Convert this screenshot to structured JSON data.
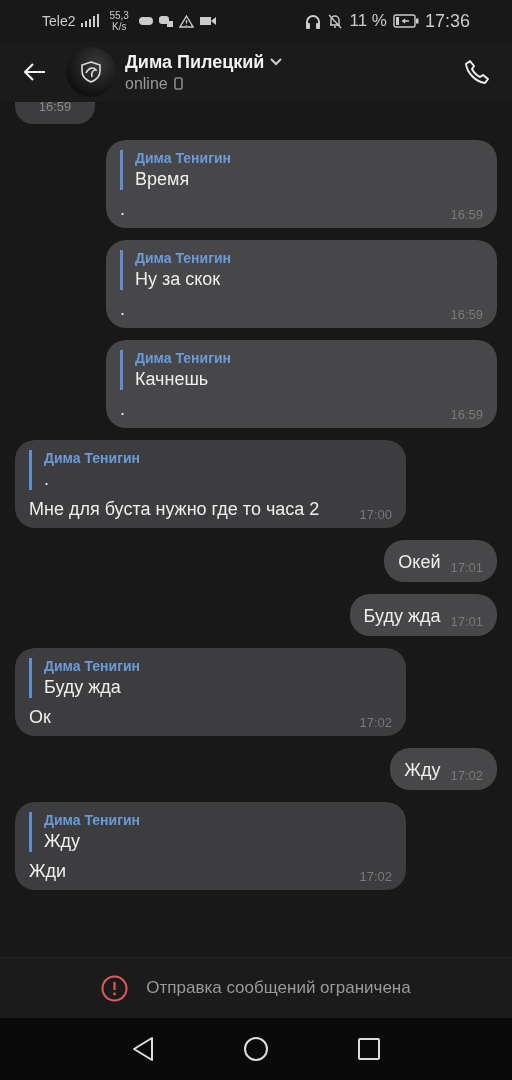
{
  "status_bar": {
    "carrier": "Tele2",
    "net_speed": "55,3",
    "net_speed_unit": "K/s",
    "battery_percent": "11 %",
    "time": "17:36"
  },
  "header": {
    "name": "Дима Пилецкий",
    "status": "online"
  },
  "messages": [
    {
      "kind": "partial_incoming",
      "time": "16:59"
    },
    {
      "kind": "reply_outgoing",
      "quote_author": "Дима Тенигин",
      "quote_text": "Время",
      "text": ".",
      "time": "16:59"
    },
    {
      "kind": "reply_outgoing",
      "quote_author": "Дима Тенигин",
      "quote_text": "Ну за скок",
      "text": ".",
      "time": "16:59"
    },
    {
      "kind": "reply_outgoing",
      "quote_author": "Дима Тенигин",
      "quote_text": "Качнешь",
      "text": ".",
      "time": "16:59"
    },
    {
      "kind": "reply_incoming",
      "quote_author": "Дима Тенигин",
      "quote_text": ".",
      "text": "Мне для буста нужно где то часа 2",
      "time": "17:00"
    },
    {
      "kind": "plain_outgoing",
      "text": "Окей",
      "time": "17:01"
    },
    {
      "kind": "plain_outgoing",
      "text": "Буду жда",
      "time": "17:01"
    },
    {
      "kind": "reply_incoming",
      "quote_author": "Дима Тенигин",
      "quote_text": "Буду жда",
      "text": "Ок",
      "time": "17:02"
    },
    {
      "kind": "plain_outgoing",
      "text": "Жду",
      "time": "17:02"
    },
    {
      "kind": "reply_incoming",
      "quote_author": "Дима Тенигин",
      "quote_text": "Жду",
      "text": "Жди",
      "time": "17:02"
    }
  ],
  "notice": "Отправка сообщений ограничена"
}
